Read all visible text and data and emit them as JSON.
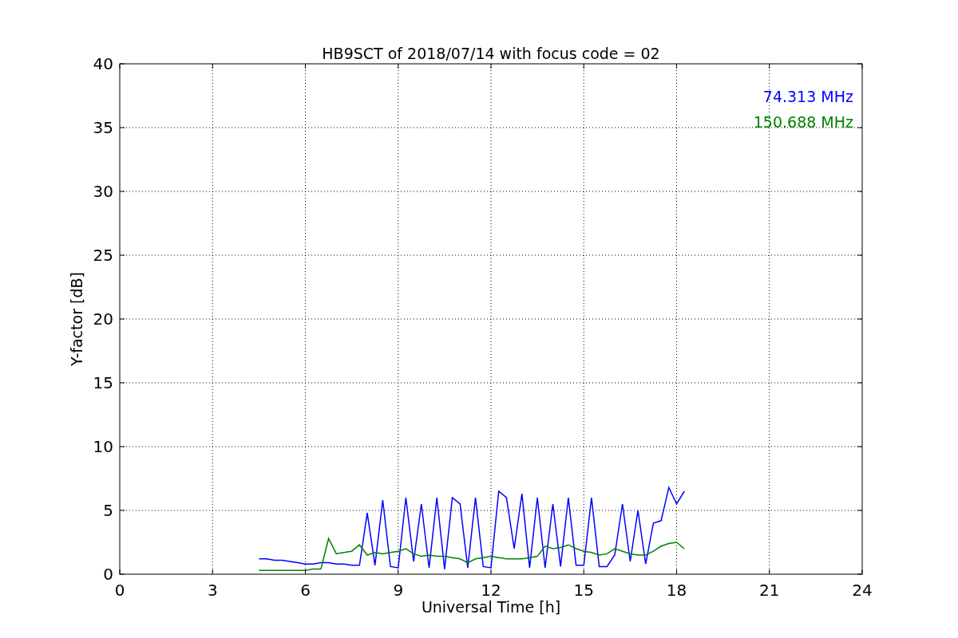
{
  "chart_data": {
    "type": "line",
    "title": "HB9SCT of 2018/07/14 with focus code = 02",
    "xlabel": "Universal Time [h]",
    "ylabel": "Y-factor [dB]",
    "x": [
      4.5,
      4.75,
      5,
      5.25,
      5.5,
      5.75,
      6,
      6.25,
      6.5,
      6.75,
      7,
      7.25,
      7.5,
      7.75,
      8,
      8.25,
      8.5,
      8.75,
      9,
      9.25,
      9.5,
      9.75,
      10,
      10.25,
      10.5,
      10.75,
      11,
      11.25,
      11.5,
      11.75,
      12,
      12.25,
      12.5,
      12.75,
      13,
      13.25,
      13.5,
      13.75,
      14,
      14.25,
      14.5,
      14.75,
      15,
      15.25,
      15.5,
      15.75,
      16,
      16.25,
      16.5,
      16.75,
      17,
      17.25,
      17.5,
      17.75,
      18,
      18.25
    ],
    "series": [
      {
        "name": "74.313 MHz",
        "color": "#0000ff",
        "values": [
          1.2,
          1.2,
          1.1,
          1.1,
          1.0,
          0.9,
          0.8,
          0.8,
          0.9,
          0.9,
          0.8,
          0.8,
          0.7,
          0.7,
          4.8,
          0.7,
          5.8,
          0.6,
          0.5,
          6.0,
          1.0,
          5.5,
          0.5,
          6.0,
          0.4,
          6.0,
          5.5,
          0.5,
          6.0,
          0.6,
          0.5,
          6.5,
          6.0,
          2.0,
          6.3,
          0.5,
          6.0,
          0.5,
          5.5,
          0.6,
          6.0,
          0.7,
          0.7,
          6.0,
          0.6,
          0.6,
          1.5,
          5.5,
          1.0,
          5.0,
          0.8,
          4.0,
          4.2,
          6.8,
          5.5,
          6.5
        ]
      },
      {
        "name": "150.688 MHz",
        "color": "#008000",
        "values": [
          0.3,
          0.3,
          0.3,
          0.3,
          0.3,
          0.3,
          0.3,
          0.4,
          0.4,
          2.8,
          1.6,
          1.7,
          1.8,
          2.3,
          1.5,
          1.7,
          1.6,
          1.7,
          1.8,
          2.0,
          1.6,
          1.4,
          1.5,
          1.4,
          1.4,
          1.3,
          1.2,
          0.9,
          1.2,
          1.3,
          1.4,
          1.3,
          1.2,
          1.2,
          1.2,
          1.3,
          1.4,
          2.2,
          2.0,
          2.1,
          2.3,
          2.0,
          1.8,
          1.7,
          1.5,
          1.6,
          2.0,
          1.8,
          1.6,
          1.5,
          1.5,
          1.8,
          2.2,
          2.4,
          2.5,
          2.0
        ]
      }
    ],
    "grid": true,
    "xlim": [
      0,
      24
    ],
    "ylim": [
      0,
      40
    ],
    "xticks": [
      0,
      3,
      6,
      9,
      12,
      15,
      18,
      21,
      24
    ],
    "yticks": [
      0,
      5,
      10,
      15,
      20,
      25,
      30,
      35,
      40
    ]
  }
}
